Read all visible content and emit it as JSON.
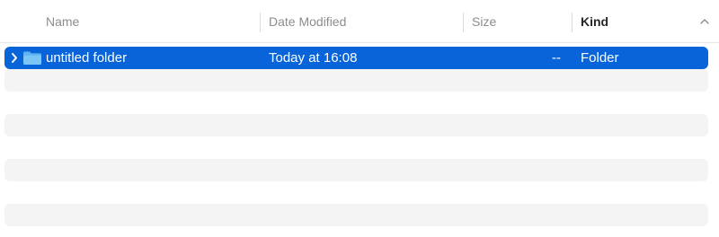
{
  "columns": {
    "name": "Name",
    "date_modified": "Date Modified",
    "size": "Size",
    "kind": "Kind"
  },
  "sort": {
    "column": "kind",
    "direction": "ascending",
    "icon": "chevron-up-icon"
  },
  "rows": [
    {
      "name": "untitled folder",
      "date_modified": "Today at 16:08",
      "size": "--",
      "kind": "Folder",
      "selected": true,
      "expandable": true,
      "icon": "folder-icon"
    }
  ],
  "colors": {
    "selection": "#0a64d9",
    "stripe": "#f4f4f5",
    "header_text": "#8c8c8c",
    "sorted_header_text": "#262626"
  }
}
